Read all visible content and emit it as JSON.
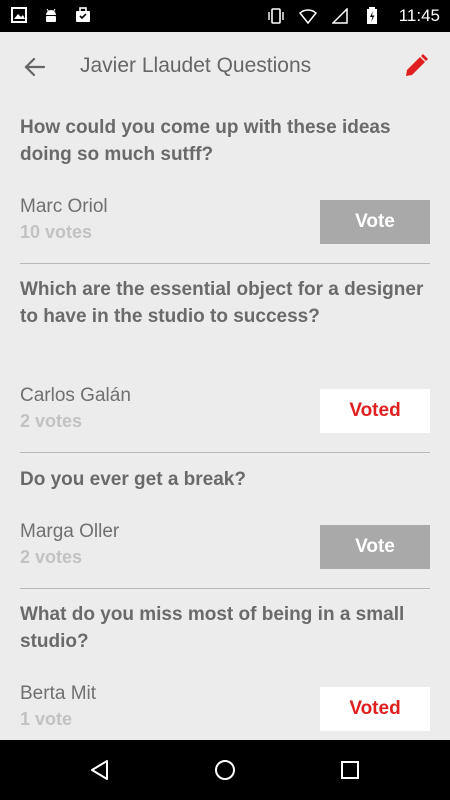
{
  "status_bar": {
    "time": "11:45",
    "left_icons": [
      "image-icon",
      "android-icon",
      "briefcase-icon"
    ],
    "right_icons": [
      "vibrate-icon",
      "wifi-icon",
      "signal-icon",
      "battery-icon"
    ]
  },
  "toolbar": {
    "title": "Javier Llaudet Questions",
    "accent_color": "#e02020"
  },
  "questions": [
    {
      "text": "How could you come up with these ideas doing so much sutff?",
      "author": "Marc Oriol",
      "votes": "10 votes",
      "button_label": "Vote",
      "voted": false
    },
    {
      "text": "Which are the essential object for a designer to have in the studio to success?",
      "author": "Carlos Galán",
      "votes": "2 votes",
      "button_label": "Voted",
      "voted": true
    },
    {
      "text": "Do you ever get a break?",
      "author": "Marga Oller",
      "votes": "2 votes",
      "button_label": "Vote",
      "voted": false
    },
    {
      "text": "What do you miss most of being in a small studio?",
      "author": "Berta Mit",
      "votes": "1 vote",
      "button_label": "Voted",
      "voted": true
    }
  ],
  "nav_bar": {
    "icons": [
      "back-triangle-icon",
      "home-circle-icon",
      "recents-square-icon"
    ]
  }
}
